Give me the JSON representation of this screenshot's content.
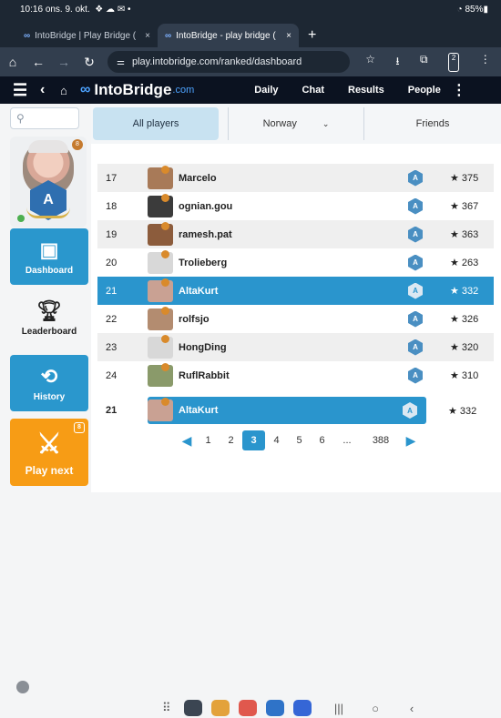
{
  "status_bar": {
    "time": "10:16",
    "date": "ons. 9. okt.",
    "icons": "❖ ☁ ✉ •",
    "battery": "85%"
  },
  "browser": {
    "tabs": [
      {
        "logo": "∞",
        "title": "IntoBridge | Play Bridge (",
        "close": "×"
      },
      {
        "logo": "∞",
        "title": "IntoBridge - play bridge (",
        "close": "×"
      }
    ],
    "new_tab": "+",
    "url": "play.intobridge.com/ranked/dashboard"
  },
  "app_nav": {
    "brand_name": "IntoBridge",
    "brand_domain": ".com",
    "links": [
      "Daily",
      "Chat",
      "Results",
      "People"
    ]
  },
  "sidebar": {
    "avatar_badge_letter": "A",
    "avatar_count": "8",
    "items": [
      {
        "label": "Dashboard",
        "icon": "dashboard-icon"
      },
      {
        "label": "Leaderboard",
        "icon": "trophy-icon"
      },
      {
        "label": "History",
        "icon": "history-icon"
      },
      {
        "label": "Play next",
        "icon": "swords-icon",
        "count": "8"
      }
    ]
  },
  "filters": {
    "all": "All players",
    "country": "Norway",
    "friends": "Friends"
  },
  "leaderboard": {
    "rows": [
      {
        "rank": "17",
        "name": "Marcelo",
        "score": "★ 375",
        "avatar_color": "#a87a58"
      },
      {
        "rank": "18",
        "name": "ognian.gou",
        "score": "★ 367",
        "avatar_color": "#3b3b3b"
      },
      {
        "rank": "19",
        "name": "ramesh.pat",
        "score": "★ 363",
        "avatar_color": "#8c5c3c"
      },
      {
        "rank": "20",
        "name": "Trolieberg",
        "score": "★ 263",
        "avatar_color": "#d8d8d8"
      },
      {
        "rank": "21",
        "name": "AltaKurt",
        "score": "★ 332",
        "avatar_color": "#c9a193",
        "me": true
      },
      {
        "rank": "22",
        "name": "rolfsjo",
        "score": "★ 326",
        "avatar_color": "#b38c70"
      },
      {
        "rank": "23",
        "name": "HongDing",
        "score": "★ 320",
        "avatar_color": "#d8d8d8"
      },
      {
        "rank": "24",
        "name": "RuflRabbit",
        "score": "★ 310",
        "avatar_color": "#8a9a6a"
      }
    ],
    "badge_letter": "A",
    "my_row": {
      "rank": "21",
      "name": "AltaKurt",
      "score": "★ 332",
      "avatar_color": "#c9a193"
    }
  },
  "pagination": {
    "pages": [
      "1",
      "2",
      "3",
      "4",
      "5",
      "6"
    ],
    "active": "3",
    "gap": "...",
    "last": "388"
  },
  "colors": {
    "accent": "#2a95cd",
    "play": "#f79c15",
    "nav_bg": "#0b1220"
  }
}
